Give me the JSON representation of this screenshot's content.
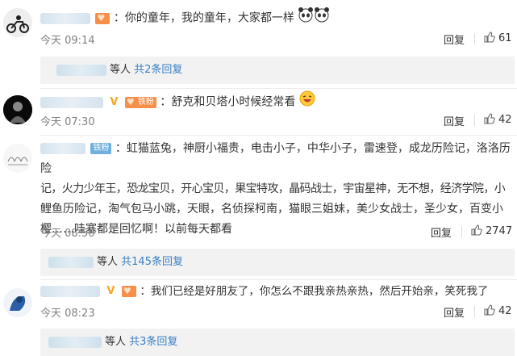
{
  "comments": [
    {
      "badge": "",
      "text": "：你的童年，我的童年，大家都一样",
      "time": "今天 09:14",
      "reply_label": "回复",
      "likes": "61",
      "sub": {
        "prefix": "等人",
        "more": "共2条回复"
      }
    },
    {
      "badge": "铁粉",
      "text": "：舒克和贝塔小时候经常看",
      "time": "今天 07:30",
      "reply_label": "回复",
      "likes": "42"
    },
    {
      "badge": "铁粉",
      "text_lines": [
        "：虹猫蓝兔，神厨小福贵，电击小子，中华小子，雷速登，成龙历险记，洛洛历险",
        "记，火力少年王，恐龙宝贝，开心宝贝，果宝特攻，晶码战士，宇宙星神，无不想，经济学院，小",
        "鲤鱼历险记，淘气包马小跳，天眼，名侦探柯南，猫眼三姐妹，美少女战士，圣少女，百变小",
        "樱……哇塞都是回忆啊！以前每天都看"
      ],
      "time": "今天 08:50",
      "reply_label": "回复",
      "likes": "2747",
      "sub": {
        "prefix": "等人",
        "more": "共145条回复"
      }
    },
    {
      "badge": "",
      "text": "：我们已经是好朋友了，你怎么不跟我亲热亲热，然后开始亲，笑死我了",
      "time": "今天 08:23",
      "reply_label": "回复",
      "likes": "42",
      "sub": {
        "prefix": "等人",
        "more": "共3条回复"
      }
    }
  ],
  "colors": {
    "link": "#3a7fc4",
    "muted": "#808080",
    "fan_badge": "#f58f4a",
    "fan_badge_blue": "#6fb0dd",
    "v_badge": "#f5a623"
  },
  "icons": [
    "thumbs-up-icon",
    "panda-emoji",
    "laughing-emoji",
    "v-verified-icon",
    "heart-icon"
  ]
}
